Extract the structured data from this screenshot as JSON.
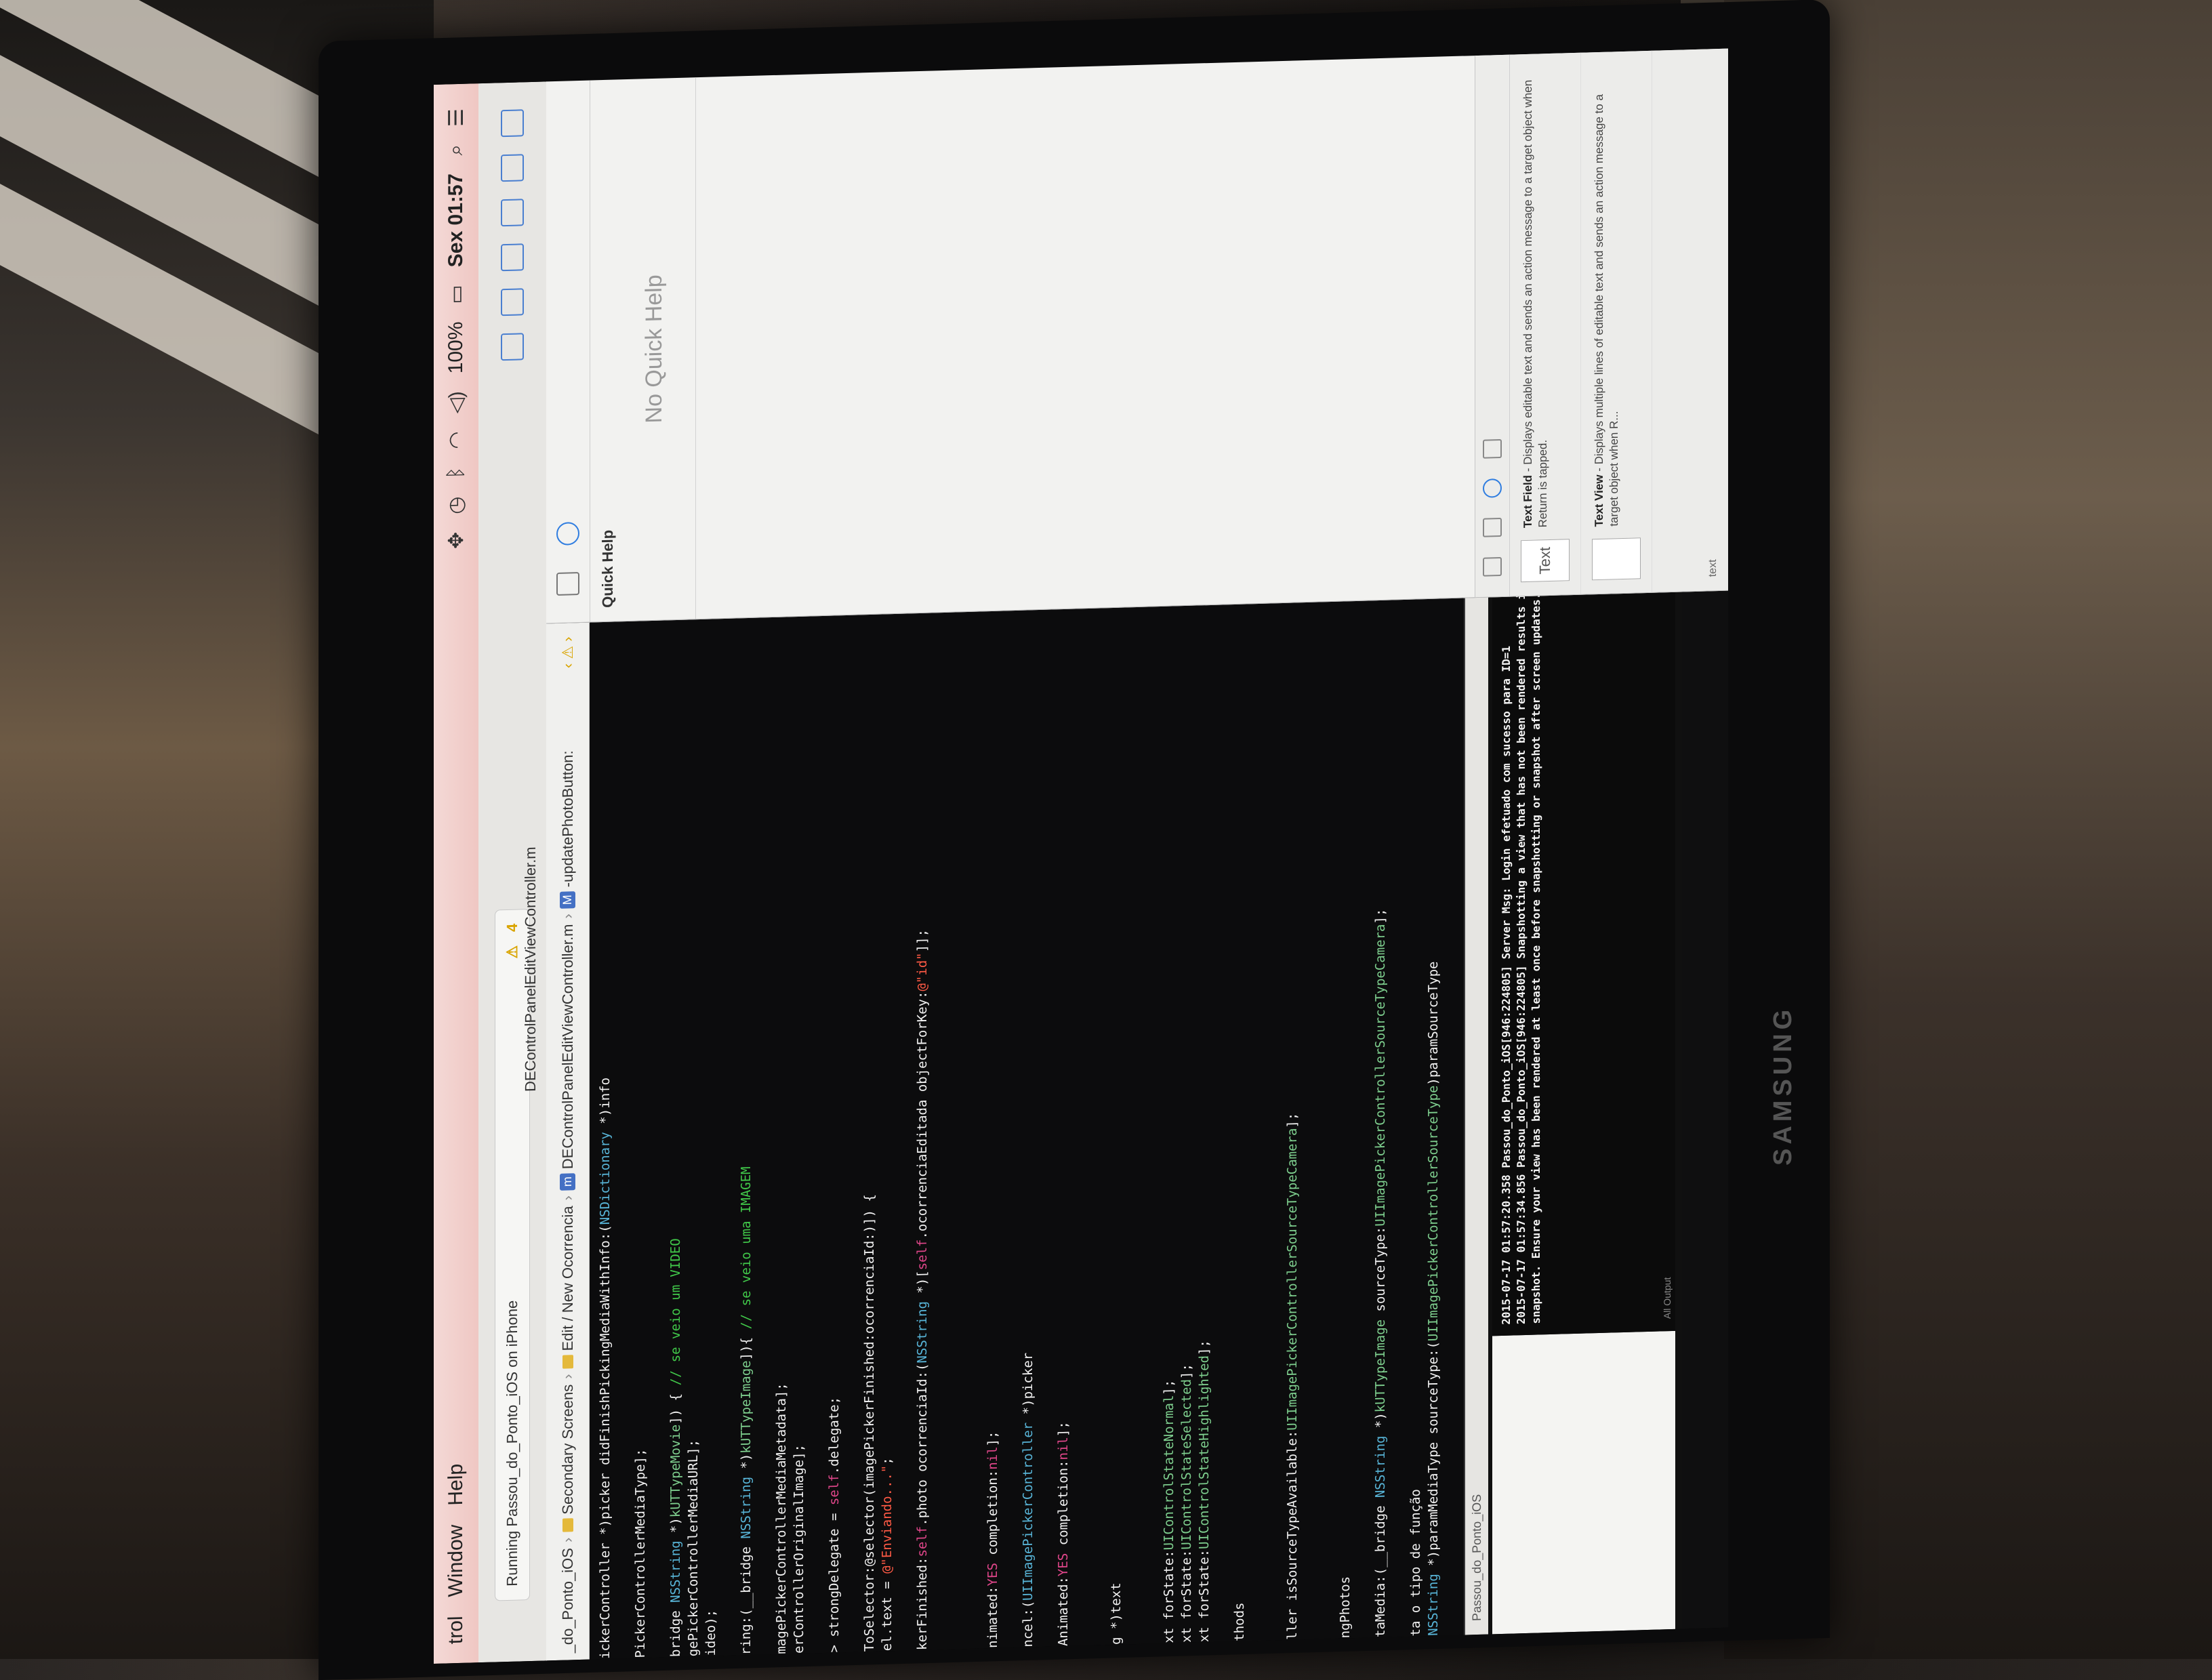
{
  "menubar": {
    "items": [
      "trol",
      "Window",
      "Help"
    ],
    "clock": "Sex 01:57",
    "battery": "100%"
  },
  "toolbar": {
    "status": "Running Passou_do_Ponto_iOS on iPhone",
    "warnings": "4"
  },
  "jumpbar": {
    "crumbs": [
      "_do_Ponto_iOS",
      "Secondary Screens",
      "Edit / New Ocorrencia",
      "DEControlPanelEditViewController.m",
      "-updatePhotoButton:"
    ],
    "file_title": "DEControlPanelEditViewController.m"
  },
  "code": [
    "ickerController *)picker didFinishPickingMediaWithInfo:(NSDictionary *)info",
    "",
    "PickerControllerMediaType];",
    "",
    "bridge NSString *)kUTTypeMovie]) { // se veio um VIDEO",
    "gePickerControllerMediaURL];",
    "ideo);",
    "",
    "ring:(__bridge NSString *)kUTTypeImage]){ // se veio uma IMAGEM",
    "",
    "magePickerControllerMediaMetadata];",
    "erControllerOriginalImage];",
    "",
    "> strongDelegate = self.delegate;",
    "",
    "ToSelector:@selector(imagePickerFinished:ocorrenciaId:)]) {",
    "el.text = @\"Enviando...\";",
    "",
    "kerFinished:self.photo ocorrenciaId:(NSString *)[self.ocorrenciaEditada objectForKey:@\"id\"]];",
    "",
    "",
    "",
    "nimated:YES completion:nil];",
    "",
    "ncel:(UIImagePickerController *)picker",
    "",
    "Animated:YES completion:nil];",
    "",
    "",
    "g *)text",
    "",
    "",
    "xt forState:UIControlStateNormal];",
    "xt forState:UIControlStateSelected];",
    "xt forState:UIControlStateHighlighted];",
    "",
    "thods",
    "",
    "",
    "ller isSourceTypeAvailable:UIImagePickerControllerSourceTypeCamera];",
    "",
    "",
    "ngPhotos",
    "",
    "taMedia:(__bridge NSString *)kUTTypeImage sourceType:UIImagePickerControllerSourceTypeCamera];",
    "",
    "ta o tipo de função",
    "NSString *)paramMediaType sourceType:(UIImagePickerControllerSourceType)paramSourceType"
  ],
  "console": {
    "lines": [
      "2015-07-17 01:57:20.358 Passou_do_Ponto_iOS[946:224805] Server Msg: Login efetuado com sucesso para ID=1",
      "2015-07-17 01:57:34.856 Passou_do_Ponto_iOS[946:224805] Snapshotting a view that has not been rendered results in an empty",
      "snapshot. Ensure your view has been rendered at least once before snapshotting or snapshot after screen updates."
    ],
    "filter": "All Output",
    "target": "Passou_do_Ponto_iOS"
  },
  "inspector": {
    "title": "Quick Help",
    "empty": "No Quick Help",
    "library": [
      {
        "thumb": "Text",
        "name": "Text Field",
        "desc": "- Displays editable text and sends an action message to a target object when Return is tapped."
      },
      {
        "thumb": "",
        "name": "Text View",
        "desc": "- Displays multiple lines of editable text and sends an action message to a target object when R..."
      }
    ],
    "search": "text"
  },
  "brand": "SAMSUNG"
}
